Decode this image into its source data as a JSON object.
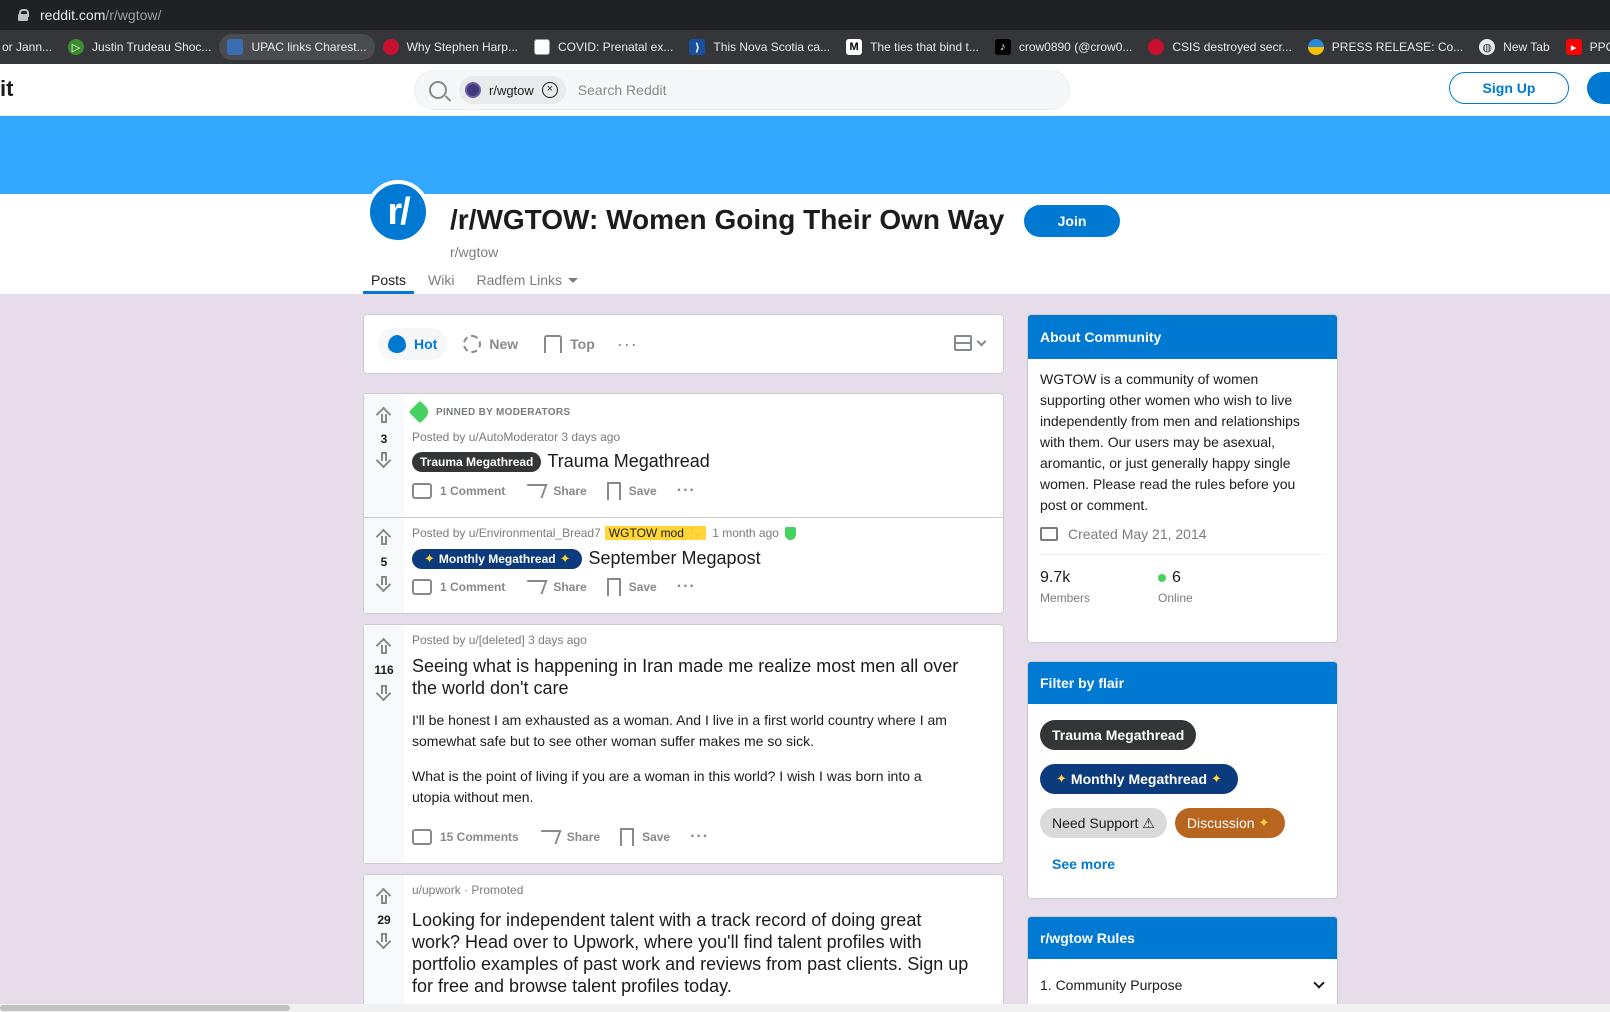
{
  "browser": {
    "url_host": "reddit.com",
    "url_path": "/r/wgtow/",
    "bookmarks": [
      {
        "label": "or Jann...",
        "color": "#35363a",
        "glyph": ""
      },
      {
        "label": "Justin Trudeau Shoc...",
        "color": "#3c8d2f",
        "glyph": "▷"
      },
      {
        "label": "UPAC links Charest...",
        "color": "#3b6db4",
        "glyph": ""
      },
      {
        "label": "Why Stephen Harp...",
        "color": "#c8102e",
        "glyph": "✦"
      },
      {
        "label": "COVID: Prenatal ex...",
        "color": "#ffffff",
        "glyph": ""
      },
      {
        "label": "This Nova Scotia ca...",
        "color": "#1a4fa0",
        "glyph": "⟩"
      },
      {
        "label": "The ties that bind t...",
        "color": "#000000",
        "glyph": "M"
      },
      {
        "label": "crow0890 (@crow0...",
        "color": "#000000",
        "glyph": "♪"
      },
      {
        "label": "CSIS destroyed secr...",
        "color": "#c8102e",
        "glyph": "✦"
      },
      {
        "label": "PRESS RELEASE: Co...",
        "color": "#2a8bd8",
        "glyph": ""
      },
      {
        "label": "New Tab",
        "color": "#5f6368",
        "glyph": "◍"
      },
      {
        "label": "PPC Leader Ma",
        "color": "#ff0000",
        "glyph": "▸"
      }
    ]
  },
  "header": {
    "logo_text": "it",
    "search_chip": "r/wgtow",
    "search_placeholder": "Search Reddit",
    "signup_label": "Sign Up"
  },
  "subreddit": {
    "icon_text": "r/",
    "title": "/r/WGTOW: Women Going Their Own Way",
    "name": "r/wgtow",
    "join_label": "Join",
    "tabs": [
      "Posts",
      "Wiki",
      "Radfem Links"
    ]
  },
  "sortbar": {
    "hot": "Hot",
    "new": "New",
    "top": "Top",
    "more": "···"
  },
  "posts": [
    {
      "pinned_label": "PINNED BY MODERATORS",
      "votes": "3",
      "meta": "Posted by u/AutoModerator 3 days ago",
      "flair": "Trauma Megathread",
      "title": "Trauma Megathread",
      "comments": "1 Comment",
      "share": "Share",
      "save": "Save"
    },
    {
      "votes": "5",
      "meta_prefix": "Posted by u/Environmental_Bread7",
      "mod_flair": "WGTOW mod",
      "meta_time": "1 month ago",
      "flair": "Monthly Megathread",
      "title": "September Megapost",
      "comments": "1 Comment",
      "share": "Share",
      "save": "Save"
    },
    {
      "votes": "116",
      "meta": "Posted by u/[deleted] 3 days ago",
      "title_line1": "Seeing what is happening in Iran made me realize most men all over",
      "title_line2": "the world don't care",
      "p1_line1": "I'll be honest I am exhausted as a woman. And I live in a first world country where I am",
      "p1_line2": "somewhat safe but to see other woman suffer makes me so sick.",
      "p2_line1": "What is the point of living if you are a woman in this world? I wish I was born into a",
      "p2_line2": "utopia without men.",
      "comments": "15 Comments",
      "share": "Share",
      "save": "Save"
    },
    {
      "votes": "29",
      "author": "u/upwork",
      "promoted": "· Promoted",
      "title_lines": [
        "Looking for independent talent with a track record of doing great",
        "work? Head over to Upwork, where you'll find talent profiles with",
        "portfolio examples of past work and reviews from past clients. Sign up",
        "for free and browse talent profiles today."
      ]
    }
  ],
  "sidebar": {
    "about_title": "About Community",
    "about_lines": [
      "WGTOW is a community of women",
      "supporting other women who wish to live",
      "independently from men and relationships",
      "with them. Our users may be asexual,",
      "aromantic, or just generally happy single",
      "women. Please read the rules before you",
      "post or comment."
    ],
    "created": "Created May 21, 2014",
    "members_value": "9.7k",
    "members_label": "Members",
    "online_value": "6",
    "online_label": "Online",
    "filter_title": "Filter by flair",
    "flair_trauma": "Trauma Megathread",
    "flair_monthly": "Monthly Megathread",
    "flair_support": "Need Support ⚠",
    "flair_discussion": "Discussion",
    "see_more": "See more",
    "rules_title": "r/wgtow Rules",
    "rule_1": "1. Community Purpose"
  }
}
